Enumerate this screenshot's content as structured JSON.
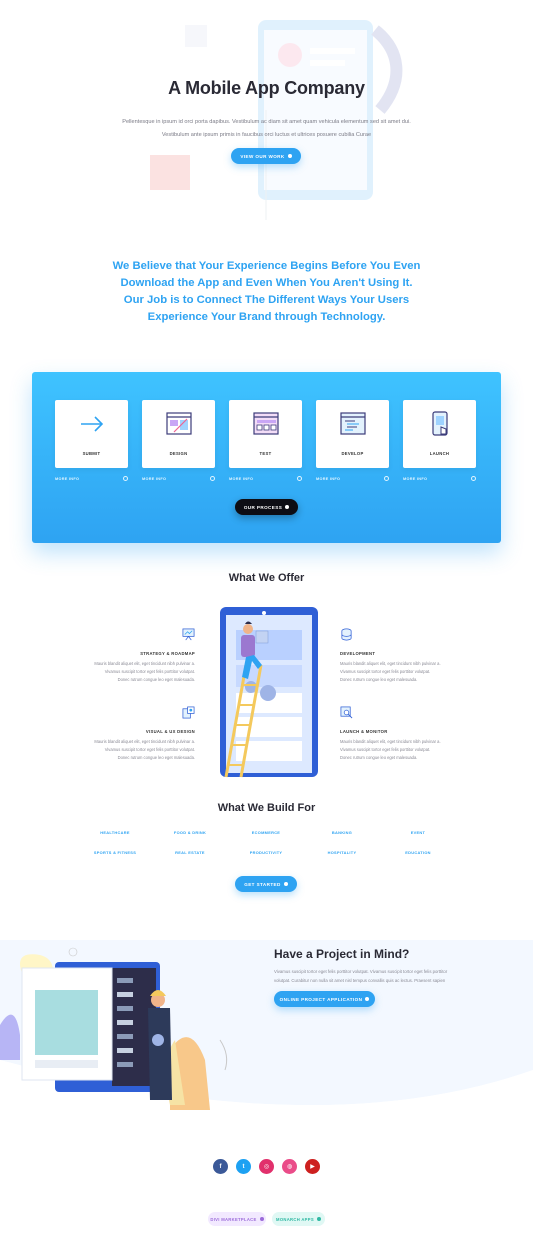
{
  "hero": {
    "title": "A Mobile App Company",
    "text_line1": "Pellentesque in ipsum id orci porta dapibus. Vestibulum ac diam sit amet quam vehicula elementum sed sit amet dui.",
    "text_line2": "Vestibulum ante ipsum primis in faucibus orci luctus et ultrices posuere cubilia Curae",
    "button_label": "View Our Work"
  },
  "believe": {
    "text": "We Believe that Your Experience Begins Before You Even Download the App and Even When You Aren't Using It.  Our Job is to Connect The Different Ways Your Users Experience Your Brand through Technology."
  },
  "process": {
    "steps": [
      {
        "label": "Submit",
        "more": "More Info",
        "icon": "arrow-right-icon"
      },
      {
        "label": "Design",
        "more": "More Info",
        "icon": "design-window-icon"
      },
      {
        "label": "Test",
        "more": "More Info",
        "icon": "test-window-icon"
      },
      {
        "label": "Develop",
        "more": "More Info",
        "icon": "code-window-icon"
      },
      {
        "label": "Launch",
        "more": "More Info",
        "icon": "phone-tap-icon"
      }
    ],
    "button_label": "Our Process"
  },
  "offer": {
    "title": "What We Offer",
    "items": [
      {
        "title": "Strategy & Roadmap",
        "icon": "presentation-board-icon",
        "line1": "Mauris blandit aliquet elit, eget tincidunt nibh pulvinar a.",
        "line2": "Vivamus suscipit tortor eget felis porttitor volutpat.",
        "line3": "Donec rutrum congue leo eget malesuada."
      },
      {
        "title": "Development",
        "icon": "database-icon",
        "line1": "Mauris blandit aliquet elit, eget tincidunt nibh pulvinar a.",
        "line2": "Vivamus suscipit tortor eget felis porttitor volutpat.",
        "line3": "Donec rutrum congue leo eget malesuada."
      },
      {
        "title": "Visual & UX Design",
        "icon": "ux-design-icon",
        "line1": "Mauris blandit aliquet elit, eget tincidunt nibh pulvinar a.",
        "line2": "Vivamus suscipit tortor eget felis porttitor volutpat.",
        "line3": "Donec rutrum congue leo eget malesuada."
      },
      {
        "title": "Launch & Monitor",
        "icon": "monitor-search-icon",
        "line1": "Mauris blandit aliquet elit, eget tincidunt nibh pulvinar a.",
        "line2": "Vivamus suscipit tortor eget felis porttitor volutpat.",
        "line3": "Donec rutrum congue leo eget malesuada."
      }
    ]
  },
  "build": {
    "title": "What We Build For",
    "tags": [
      "Healthcare",
      "Food & Drink",
      "Ecommerce",
      "Banking",
      "Event",
      "Sports & Fitness",
      "Real Estate",
      "Productivity",
      "Hospitality",
      "Education"
    ],
    "button_label": "Get Started"
  },
  "project": {
    "title": "Have a Project in Mind?",
    "text_line1": "Vivamus suscipit tortor eget felis porttitor volutpat. Vivamus suscipit tortor eget felis porttitor",
    "text_line2": "volutpat. Curabitur non nulla sit amet nisl tempus convallis quis ac lectus. Praesent sapien",
    "button_label": "Online Project Application"
  },
  "footer": {
    "social": [
      {
        "icon": "facebook-icon",
        "glyph": "f",
        "color": "#3b5998"
      },
      {
        "icon": "twitter-icon",
        "glyph": "t",
        "color": "#1da1f2"
      },
      {
        "icon": "instagram-icon",
        "glyph": "◎",
        "color": "#e1306c"
      },
      {
        "icon": "dribbble-icon",
        "glyph": "◍",
        "color": "#ea4c89"
      },
      {
        "icon": "youtube-icon",
        "glyph": "▶",
        "color": "#cd201f"
      }
    ],
    "pills": [
      {
        "label": "Divi Marketplace",
        "bg": "#f2e9ff",
        "fg": "#9b6bd9"
      },
      {
        "label": "Monarch Apps",
        "bg": "#e0f8f4",
        "fg": "#2fb8a3"
      }
    ]
  },
  "colors": {
    "accent": "#2ea3f2",
    "dark": "#2a2a35",
    "black_button": "#0d0d14"
  }
}
